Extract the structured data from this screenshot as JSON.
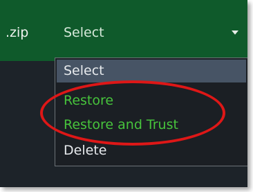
{
  "file_label": ".zip",
  "select": {
    "value": "Select"
  },
  "dropdown": {
    "options": [
      {
        "label": "Select"
      },
      {
        "label": "Restore"
      },
      {
        "label": "Restore and Trust"
      },
      {
        "label": "Delete"
      }
    ]
  },
  "colors": {
    "header": "#0f5a2b",
    "dropdown_bg": "#1b1f24",
    "selected_option": "#475465",
    "green_text": "#47c43c",
    "annotation": "#de1717"
  }
}
